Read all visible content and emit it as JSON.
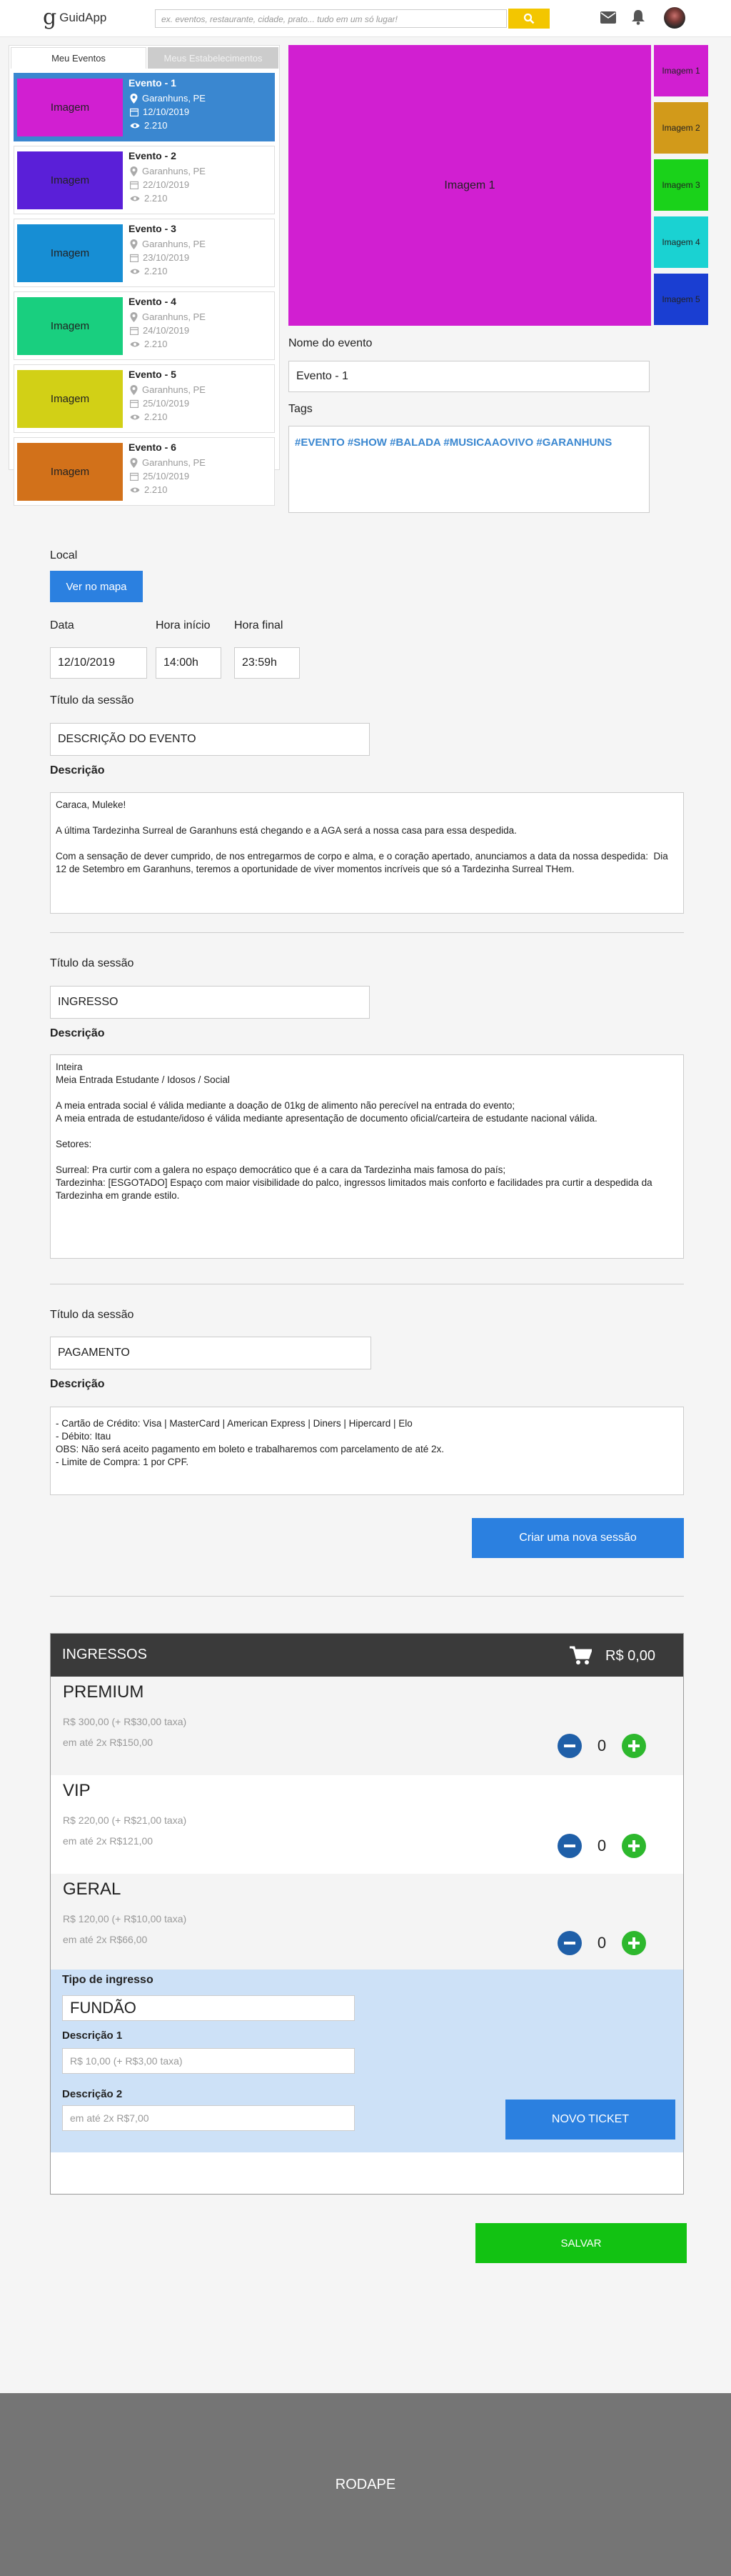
{
  "header": {
    "logo_letter": "g",
    "logo_text": "GuidApp",
    "search_placeholder": "ex. eventos, restaurante, cidade, prato... tudo em um só lugar!"
  },
  "tabs": {
    "my_events": "Meu Eventos",
    "my_establishments": "Meus Estabelecimentos"
  },
  "events": [
    {
      "title": "Evento - 1",
      "city": "Garanhuns, PE",
      "date": "12/10/2019",
      "views": "2.210",
      "image": "Imagem",
      "color": "#d11fd1",
      "selected": true
    },
    {
      "title": "Evento - 2",
      "city": "Garanhuns, PE",
      "date": "22/10/2019",
      "views": "2.210",
      "image": "Imagem",
      "color": "#5a1fd8"
    },
    {
      "title": "Evento - 3",
      "city": "Garanhuns, PE",
      "date": "23/10/2019",
      "views": "2.210",
      "image": "Imagem",
      "color": "#178ed4"
    },
    {
      "title": "Evento - 4",
      "city": "Garanhuns, PE",
      "date": "24/10/2019",
      "views": "2.210",
      "image": "Imagem",
      "color": "#19cf7f"
    },
    {
      "title": "Evento - 5",
      "city": "Garanhuns, PE",
      "date": "25/10/2019",
      "views": "2.210",
      "image": "Imagem",
      "color": "#d2d016"
    },
    {
      "title": "Evento - 6",
      "city": "Garanhuns, PE",
      "date": "25/10/2019",
      "views": "2.210",
      "image": "Imagem",
      "color": "#d2711a"
    }
  ],
  "gallery": {
    "main": "Imagem 1",
    "main_color": "#d11fd1",
    "thumbs": [
      {
        "label": "Imagem 1",
        "color": "#d11fd1"
      },
      {
        "label": "Imagem 2",
        "color": "#d29a1a"
      },
      {
        "label": "Imagem 3",
        "color": "#1ad21a"
      },
      {
        "label": "Imagem 4",
        "color": "#1ad2d2"
      },
      {
        "label": "Imagem 5",
        "color": "#1a3ed2"
      }
    ]
  },
  "event_form": {
    "name_label": "Nome do evento",
    "name_value": "Evento - 1",
    "tags_label": "Tags",
    "tags_value": "#EVENTO #SHOW #BALADA #MUSICAAOVIVO #GARANHUNS"
  },
  "location": {
    "label": "Local",
    "map_button": "Ver no mapa"
  },
  "schedule": {
    "date_label": "Data",
    "date_value": "12/10/2019",
    "start_label": "Hora início",
    "start_value": "14:00h",
    "end_label": "Hora final",
    "end_value": "23:59h"
  },
  "sessions": [
    {
      "title_label": "Título da sessão",
      "title_value": "DESCRIÇÃO DO EVENTO",
      "desc_label": "Descrição",
      "lines": [
        "Caraca, Muleke!",
        "",
        "A última Tardezinha Surreal de Garanhuns está chegando e a AGA será a nossa casa para essa despedida.",
        "",
        "Com a sensação de dever cumprido, de nos entregarmos de corpo e alma, e o coração apertado, anunciamos a data da nossa despedida:  Dia 12 de Setembro em Garanhuns, teremos a oportunidade de viver momentos incríveis que só a Tardezinha Surreal THem."
      ]
    },
    {
      "title_label": "Título da sessão",
      "title_value": "INGRESSO",
      "desc_label": "Descrição",
      "lines": [
        "Inteira",
        "Meia Entrada Estudante / Idosos / Social",
        "",
        "A meia entrada social é válida mediante a doação de 01kg de alimento não perecível na entrada do evento;",
        "A meia entrada de estudante/idoso é válida mediante apresentação de documento oficial/carteira de estudante nacional válida.",
        "",
        "Setores:",
        "",
        "Surreal: Pra curtir com a galera no espaço democrático que é a cara da Tardezinha mais famosa do país;",
        "Tardezinha: [ESGOTADO] Espaço com maior visibilidade do palco, ingressos limitados mais conforto e facilidades pra curtir a despedida da Tardezinha em grande estilo."
      ]
    },
    {
      "title_label": "Título da sessão",
      "title_value": "PAGAMENTO",
      "desc_label": "Descrição",
      "lines": [
        "- Cartão de Crédito: Visa | MasterCard | American Express | Diners | Hipercard | Elo",
        "- Débito: Itau",
        "OBS: Não será aceito pagamento em boleto e trabalharemos com parcelamento de até 2x.",
        "- Limite de Compra: 1 por CPF."
      ]
    }
  ],
  "new_session_button": "Criar uma nova sessão",
  "tickets": {
    "header": "INGRESSOS",
    "total": "R$ 0,00",
    "tiers": [
      {
        "name": "PREMIUM",
        "price": "R$ 300,00 (+ R$30,00 taxa)",
        "installment": "em até 2x R$150,00",
        "qty": "0"
      },
      {
        "name": "VIP",
        "price": "R$ 220,00 (+ R$21,00 taxa)",
        "installment": "em até 2x R$121,00",
        "qty": "0"
      },
      {
        "name": "GERAL",
        "price": "R$ 120,00 (+ R$10,00 taxa)",
        "installment": "em até 2x R$66,00",
        "qty": "0"
      }
    ],
    "new": {
      "type_label": "Tipo de ingresso",
      "type_value": "FUNDÃO",
      "desc1_label": "Descrição 1",
      "desc1_placeholder": "R$ 10,00 (+ R$3,00 taxa)",
      "desc2_label": "Descrição 2",
      "desc2_placeholder": "em até 2x R$7,00",
      "button": "NOVO TICKET"
    }
  },
  "save_button": "SALVAR",
  "footer": "RODAPE",
  "colors": {
    "accent": "#2b80e0",
    "search": "#f3c600",
    "save": "#12c212",
    "plus": "#2db82d",
    "minus": "#1f5fa8"
  }
}
